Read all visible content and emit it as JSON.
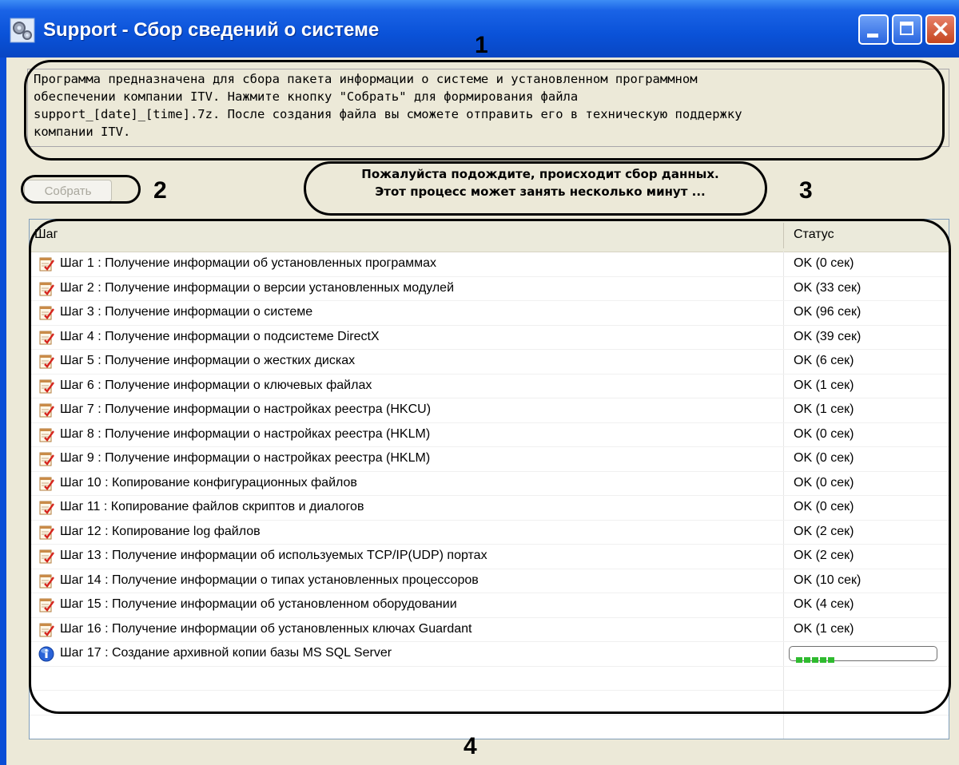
{
  "window": {
    "title": "Support - Сбор сведений о системе"
  },
  "info": {
    "text": "Программа предназначена для сбора пакета информации о системе и установленном программном\nобеспечении компании ITV. Нажмите кнопку \"Собрать\" для формирования файла\nsupport_[date]_[time].7z. После создания файла вы сможете отправить его в техническую поддержку\nкомпании ITV."
  },
  "collect_button": {
    "label": "Собрать"
  },
  "status_message": {
    "line1": "Пожалуйста подождите, происходит сбор данных.",
    "line2": "Этот процесс может занять несколько минут ..."
  },
  "list": {
    "header_step": "Шаг",
    "header_status": "Статус",
    "rows": [
      {
        "step": "Шаг 1 : Получение информации об установленных программах",
        "status": "OK (0 сек)"
      },
      {
        "step": "Шаг 2 : Получение информации о версии установленных модулей",
        "status": "OK (33 сек)"
      },
      {
        "step": "Шаг 3 : Получение информации о системе",
        "status": "OK (96 сек)"
      },
      {
        "step": "Шаг 4 : Получение информации о подсистеме DirectX",
        "status": "OK (39 сек)"
      },
      {
        "step": "Шаг 5 : Получение информации о жестких дисках",
        "status": "OK (6 сек)"
      },
      {
        "step": "Шаг 6 : Получение информации о ключевых файлах",
        "status": "OK (1 сек)"
      },
      {
        "step": "Шаг 7 : Получение информации о настройках реестра (HKCU)",
        "status": "OK (1 сек)"
      },
      {
        "step": "Шаг 8 : Получение информации о настройках реестра (HKLM)",
        "status": "OK (0 сек)"
      },
      {
        "step": "Шаг 9 : Получение информации о настройках реестра (HKLM)",
        "status": "OK (0 сек)"
      },
      {
        "step": "Шаг 10 : Копирование конфигурационных файлов",
        "status": "OK (0 сек)"
      },
      {
        "step": "Шаг 11 : Копирование файлов скриптов и диалогов",
        "status": "OK (0 сек)"
      },
      {
        "step": "Шаг 12 : Копирование log файлов",
        "status": "OK (2 сек)"
      },
      {
        "step": "Шаг 13 : Получение информации об используемых TCP/IP(UDP) портах",
        "status": "OK (2 сек)"
      },
      {
        "step": "Шаг 14 : Получение информации о типах установленных процессоров",
        "status": "OK (10 сек)"
      },
      {
        "step": "Шаг 15 : Получение информации об установленном оборудовании",
        "status": "OK (4 сек)"
      },
      {
        "step": "Шаг 16 : Получение информации об установленных ключах Guardant",
        "status": "OK (1 сек)"
      }
    ],
    "active_row": {
      "step": "Шаг 17 : Создание архивной копии базы MS SQL Server",
      "progress_blocks": 5
    }
  },
  "callouts": {
    "n1": "1",
    "n2": "2",
    "n3": "3",
    "n4": "4"
  },
  "icons": {
    "done": "notepad-check-icon",
    "active": "info-icon",
    "app": "gears-icon"
  }
}
